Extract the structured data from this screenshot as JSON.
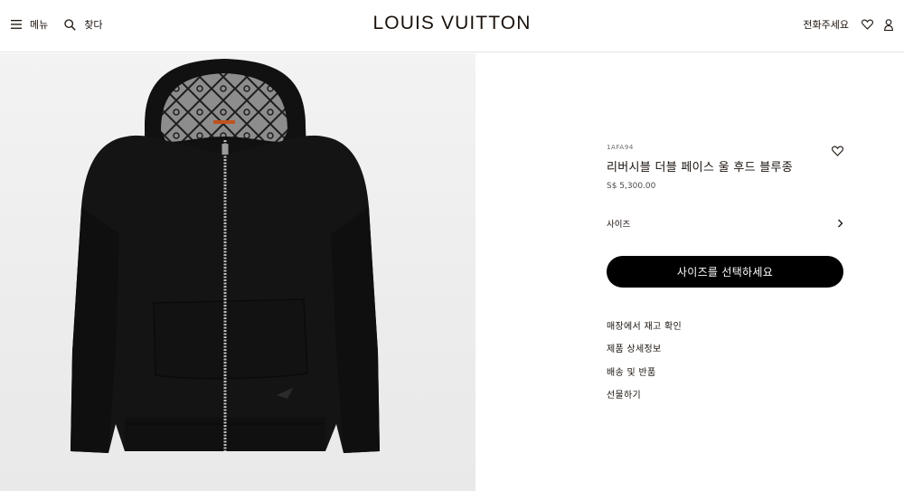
{
  "header": {
    "menu_label": "메뉴",
    "search_label": "찾다",
    "brand": "LOUIS VUITTON",
    "call_label": "전화주세요"
  },
  "product": {
    "sku": "1AFA94",
    "name": "리버시블 더블 페이스 울 후드 블루종",
    "price": "S$ 5,300.00",
    "size_label": "사이즈",
    "cta_label": "사이즈를 선택하세요",
    "links": [
      "매장에서 재고 확인",
      "제품 상세정보",
      "배송 및 반품",
      "선물하기"
    ]
  },
  "image": {
    "description_icon": "hoodie-jacket-image",
    "background_color": "#ececec",
    "garment_color": "#121212",
    "lining_color": "#8a8a8a"
  },
  "colors": {
    "text": "#19110b",
    "button_bg": "#000000",
    "button_text": "#ffffff"
  }
}
